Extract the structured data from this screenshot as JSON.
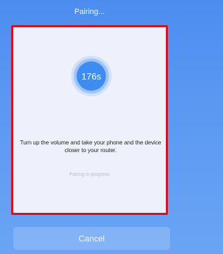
{
  "header": {
    "title": "Pairing..."
  },
  "card": {
    "timer": "176s",
    "instruction": "Turn up the volume and take your phone and the device closer to your router.",
    "status": "Pairing in progress"
  },
  "footer": {
    "cancel_label": "Cancel"
  }
}
